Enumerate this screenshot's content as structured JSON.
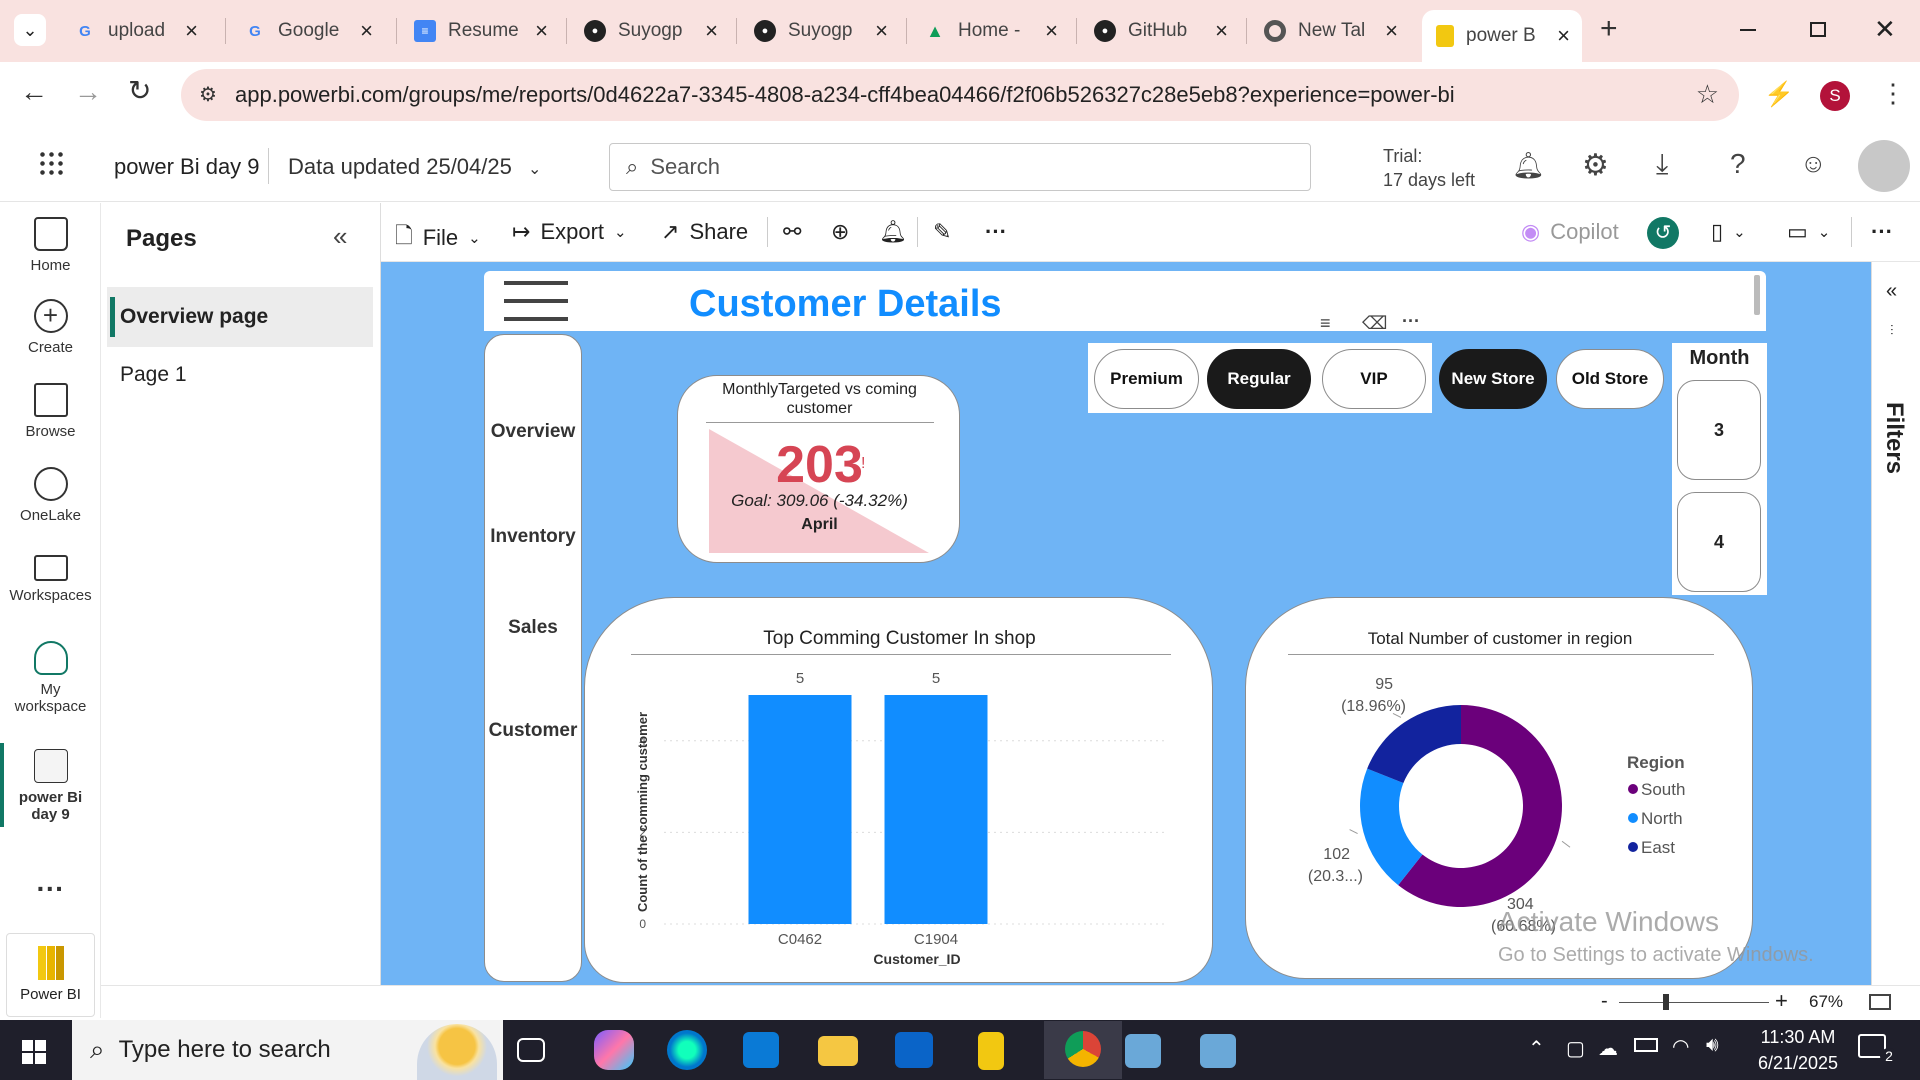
{
  "browser": {
    "tabs": [
      {
        "label": "upload",
        "icon": "google-icon"
      },
      {
        "label": "Google",
        "icon": "google-icon"
      },
      {
        "label": "Resume",
        "icon": "docs-icon"
      },
      {
        "label": "Suyogp",
        "icon": "github-icon"
      },
      {
        "label": "Suyogp",
        "icon": "github-icon"
      },
      {
        "label": "Home -",
        "icon": "drive-icon"
      },
      {
        "label": "GitHub",
        "icon": "github-icon"
      },
      {
        "label": "New Tal",
        "icon": "chrome-icon"
      },
      {
        "label": "power B",
        "icon": "powerbi-icon"
      }
    ],
    "url": "app.powerbi.com/groups/me/reports/0d4622a7-3345-4808-a234-cff4bea04466/f2f06b526327c28e5eb8?experience=power-bi",
    "profile_initial": "S"
  },
  "pbi_header": {
    "report_name": "power Bi day 9",
    "data_updated": "Data updated 25/04/25",
    "search_placeholder": "Search",
    "trial_line1": "Trial:",
    "trial_line2": "17 days left"
  },
  "rail": {
    "items": [
      {
        "label": "Home"
      },
      {
        "label": "Create"
      },
      {
        "label": "Browse"
      },
      {
        "label": "OneLake"
      },
      {
        "label": "Workspaces"
      },
      {
        "label": "My workspace"
      },
      {
        "label": "power Bi day 9"
      }
    ],
    "bottom_app": "Power BI"
  },
  "pages_pane": {
    "title": "Pages",
    "pages": [
      "Overview page",
      "Page 1"
    ]
  },
  "toolbar": {
    "file": "File",
    "export": "Export",
    "share": "Share",
    "copilot": "Copilot"
  },
  "filters_label": "Filters",
  "report": {
    "title": "Customer Details",
    "nav": [
      "Overview",
      "Inventory",
      "Sales",
      "Customer"
    ],
    "slicer_segments": [
      "Premium",
      "Regular",
      "VIP"
    ],
    "slicer_store": [
      "New Store",
      "Old Store"
    ],
    "month_title": "Month",
    "months": [
      "3",
      "4"
    ],
    "kpi": {
      "title": "MonthlyTargeted vs coming customer",
      "value": "203",
      "goal": "Goal: 309.06 (-34.32%)",
      "period": "April",
      "marker": "!"
    },
    "bar_title": "Top Comming Customer In shop",
    "donut_title": "Total Number of customer in region"
  },
  "chart_data": [
    {
      "type": "bar",
      "title": "Top Comming Customer In shop",
      "categories": [
        "C0462",
        "C1904"
      ],
      "values": [
        5,
        5
      ],
      "xlabel": "Customer_ID",
      "ylabel": "Count of the comming customer",
      "ylim": [
        0,
        5
      ],
      "yticks": [
        0,
        2,
        4
      ],
      "color": "#118dff"
    },
    {
      "type": "pie",
      "title": "Total Number of customer in region",
      "legend_title": "Region",
      "categories": [
        "South",
        "North",
        "East"
      ],
      "values": [
        304,
        102,
        95
      ],
      "labels": [
        "304 (60.68%)",
        "102 (20.3...)",
        "95 (18.96%)"
      ],
      "colors": [
        "#6b007b",
        "#118dff",
        "#12239e"
      ]
    }
  ],
  "watermark": {
    "line1": "Activate Windows",
    "line2": "Go to Settings to activate Windows."
  },
  "status": {
    "zoom": "67%"
  },
  "taskbar": {
    "search_placeholder": "Type here to search",
    "time": "11:30 AM",
    "date": "6/21/2025",
    "notif_count": "2"
  }
}
